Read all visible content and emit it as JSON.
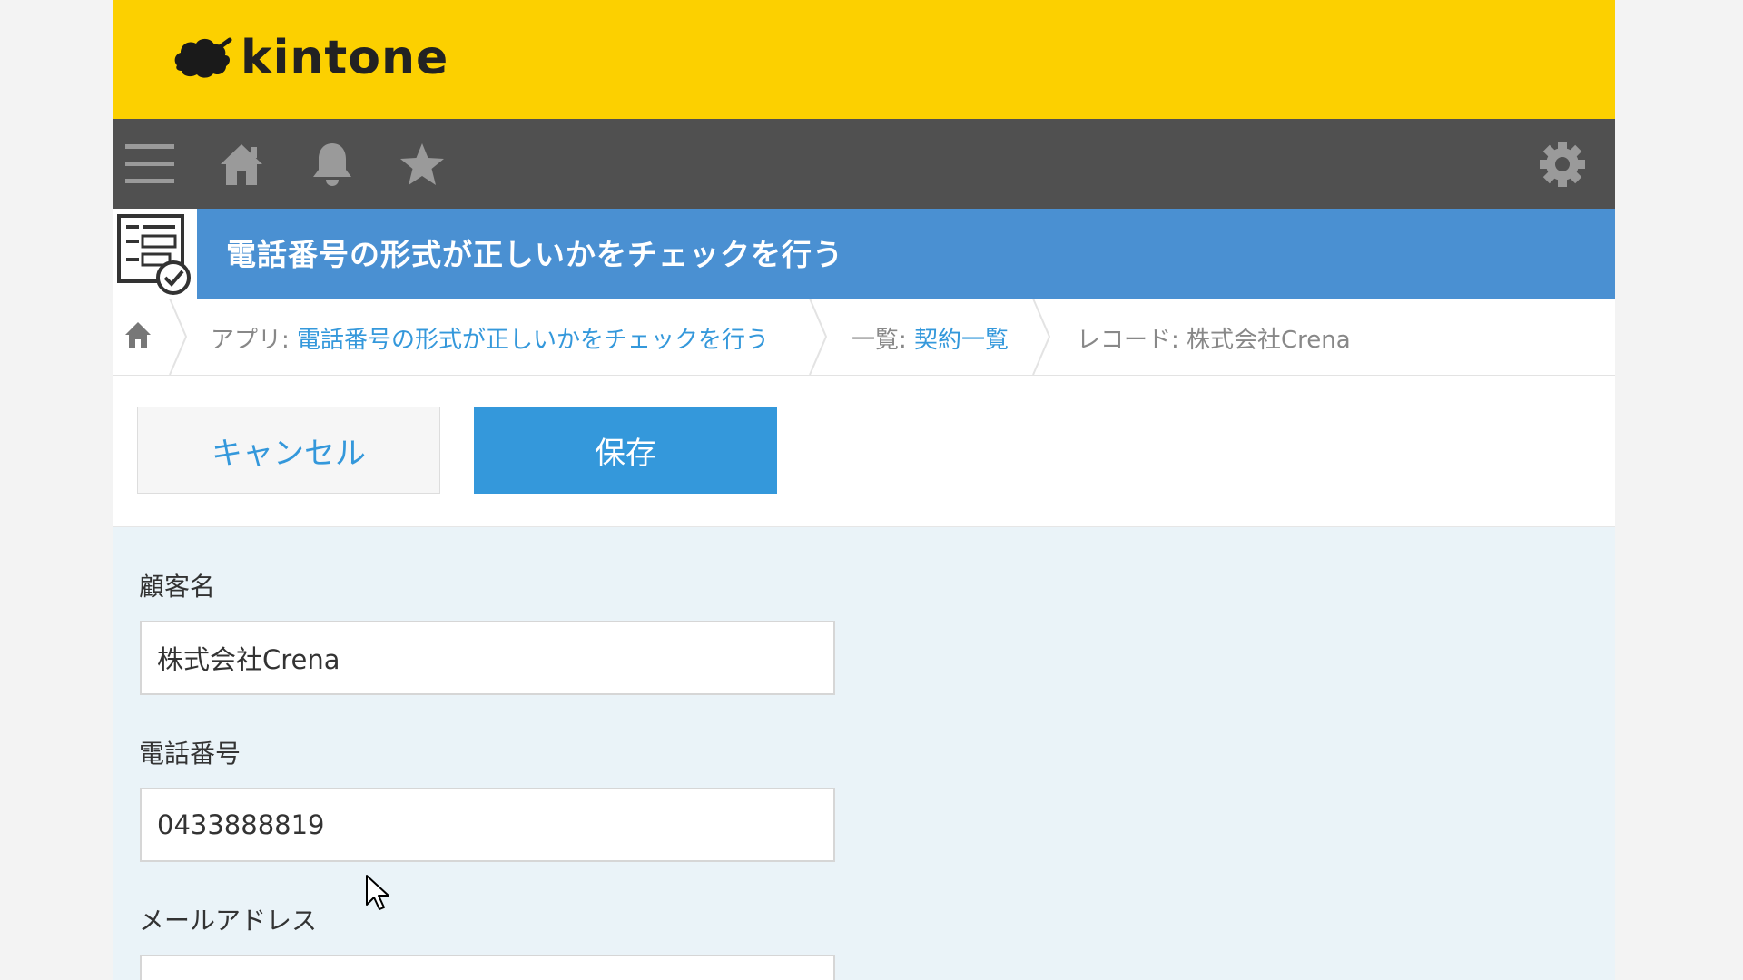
{
  "header": {
    "logo_text": "kintone"
  },
  "nav": {
    "icons": [
      "menu-icon",
      "home-icon",
      "bell-icon",
      "star-icon",
      "gear-icon"
    ]
  },
  "app": {
    "title": "電話番号の形式が正しいかをチェックを行う"
  },
  "breadcrumb": {
    "app_prefix": "アプリ: ",
    "app_name": "電話番号の形式が正しいかをチェックを行う",
    "view_prefix": "一覧: ",
    "view_name": "契約一覧",
    "record_prefix": "レコード: ",
    "record_name": "株式会社Crena"
  },
  "toolbar": {
    "cancel_label": "キャンセル",
    "save_label": "保存"
  },
  "form": {
    "fields": [
      {
        "label": "顧客名",
        "value": "株式会社Crena"
      },
      {
        "label": "電話番号",
        "value": "0433888819"
      },
      {
        "label": "メールアドレス",
        "value": ""
      }
    ]
  },
  "colors": {
    "brand_yellow": "#fcd000",
    "nav_gray": "#505050",
    "header_blue": "#4a90d2",
    "accent_blue": "#3498db",
    "form_bg": "#eaf3f8"
  }
}
